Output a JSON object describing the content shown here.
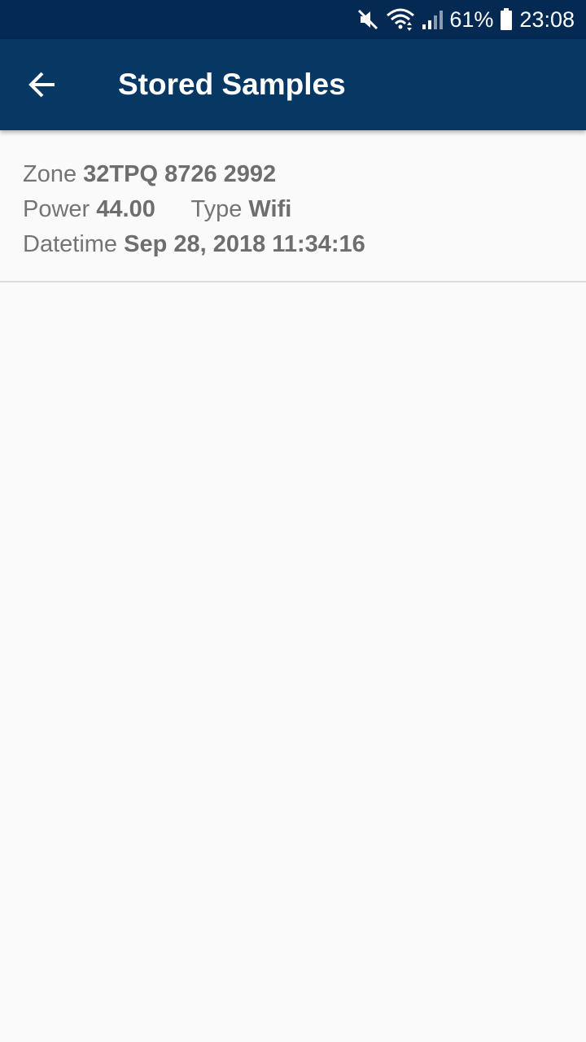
{
  "status_bar": {
    "icons": [
      "mute-icon",
      "wifi-icon",
      "signal-icon",
      "battery-icon"
    ],
    "battery": "61%",
    "time": "23:08"
  },
  "app_bar": {
    "back_icon": "arrow-left-icon",
    "title": "Stored Samples"
  },
  "colors": {
    "status_bar": "#042a53",
    "app_bar": "#073763",
    "background": "#fafafa"
  },
  "samples": [
    {
      "zone_label": "Zone",
      "zone": "32TPQ 8726 2992",
      "power_label": "Power",
      "power": "44.00",
      "type_label": "Type",
      "type": "Wifi",
      "datetime_label": "Datetime",
      "datetime": "Sep 28, 2018 11:34:16"
    }
  ]
}
